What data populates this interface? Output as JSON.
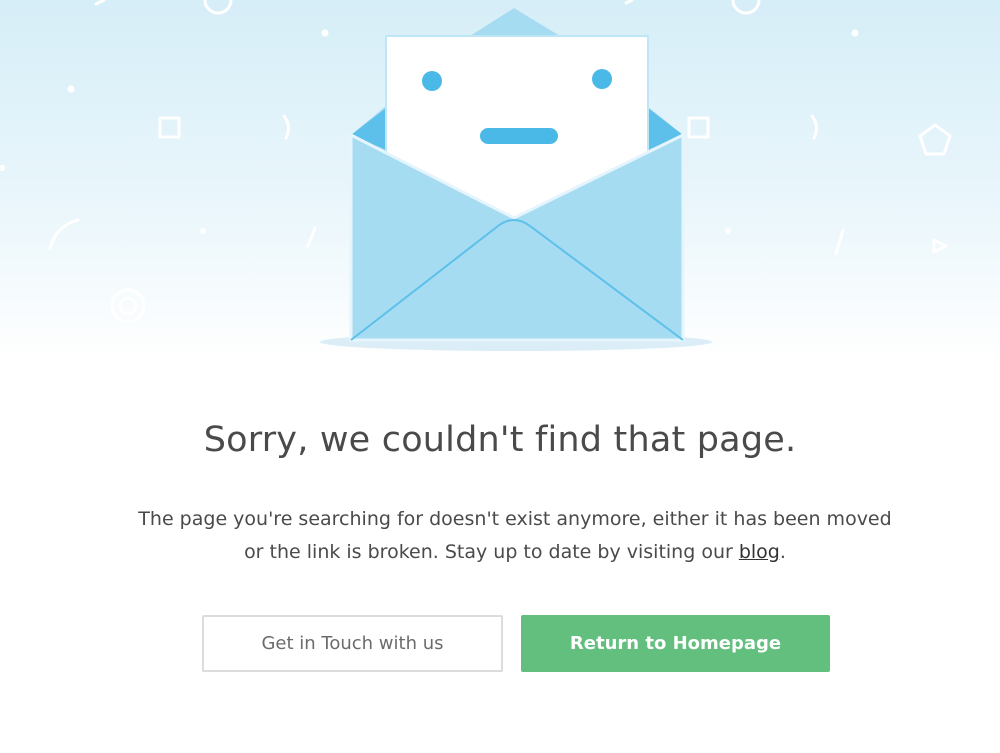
{
  "illustration": {
    "name": "open envelope with a sad letter face",
    "colors": {
      "background_top": "#d6eef8",
      "envelope": "#a6dcf2",
      "envelope_dark": "#5dc0ea",
      "letter": "#ffffff",
      "face": "#4bb9e8"
    }
  },
  "error": {
    "heading": "Sorry, we couldn't find that page.",
    "message_before_link": "The page you're searching for doesn't exist anymore, either it has been moved or the link is broken. Stay up to date by visiting our ",
    "link_label": "blog",
    "message_after_link": "."
  },
  "actions": {
    "contact_label": "Get in Touch with us",
    "home_label": "Return to Homepage"
  },
  "colors": {
    "primary_button": "#63bf7d",
    "text": "#4a4a4a",
    "outline": "#dcdcdc"
  }
}
